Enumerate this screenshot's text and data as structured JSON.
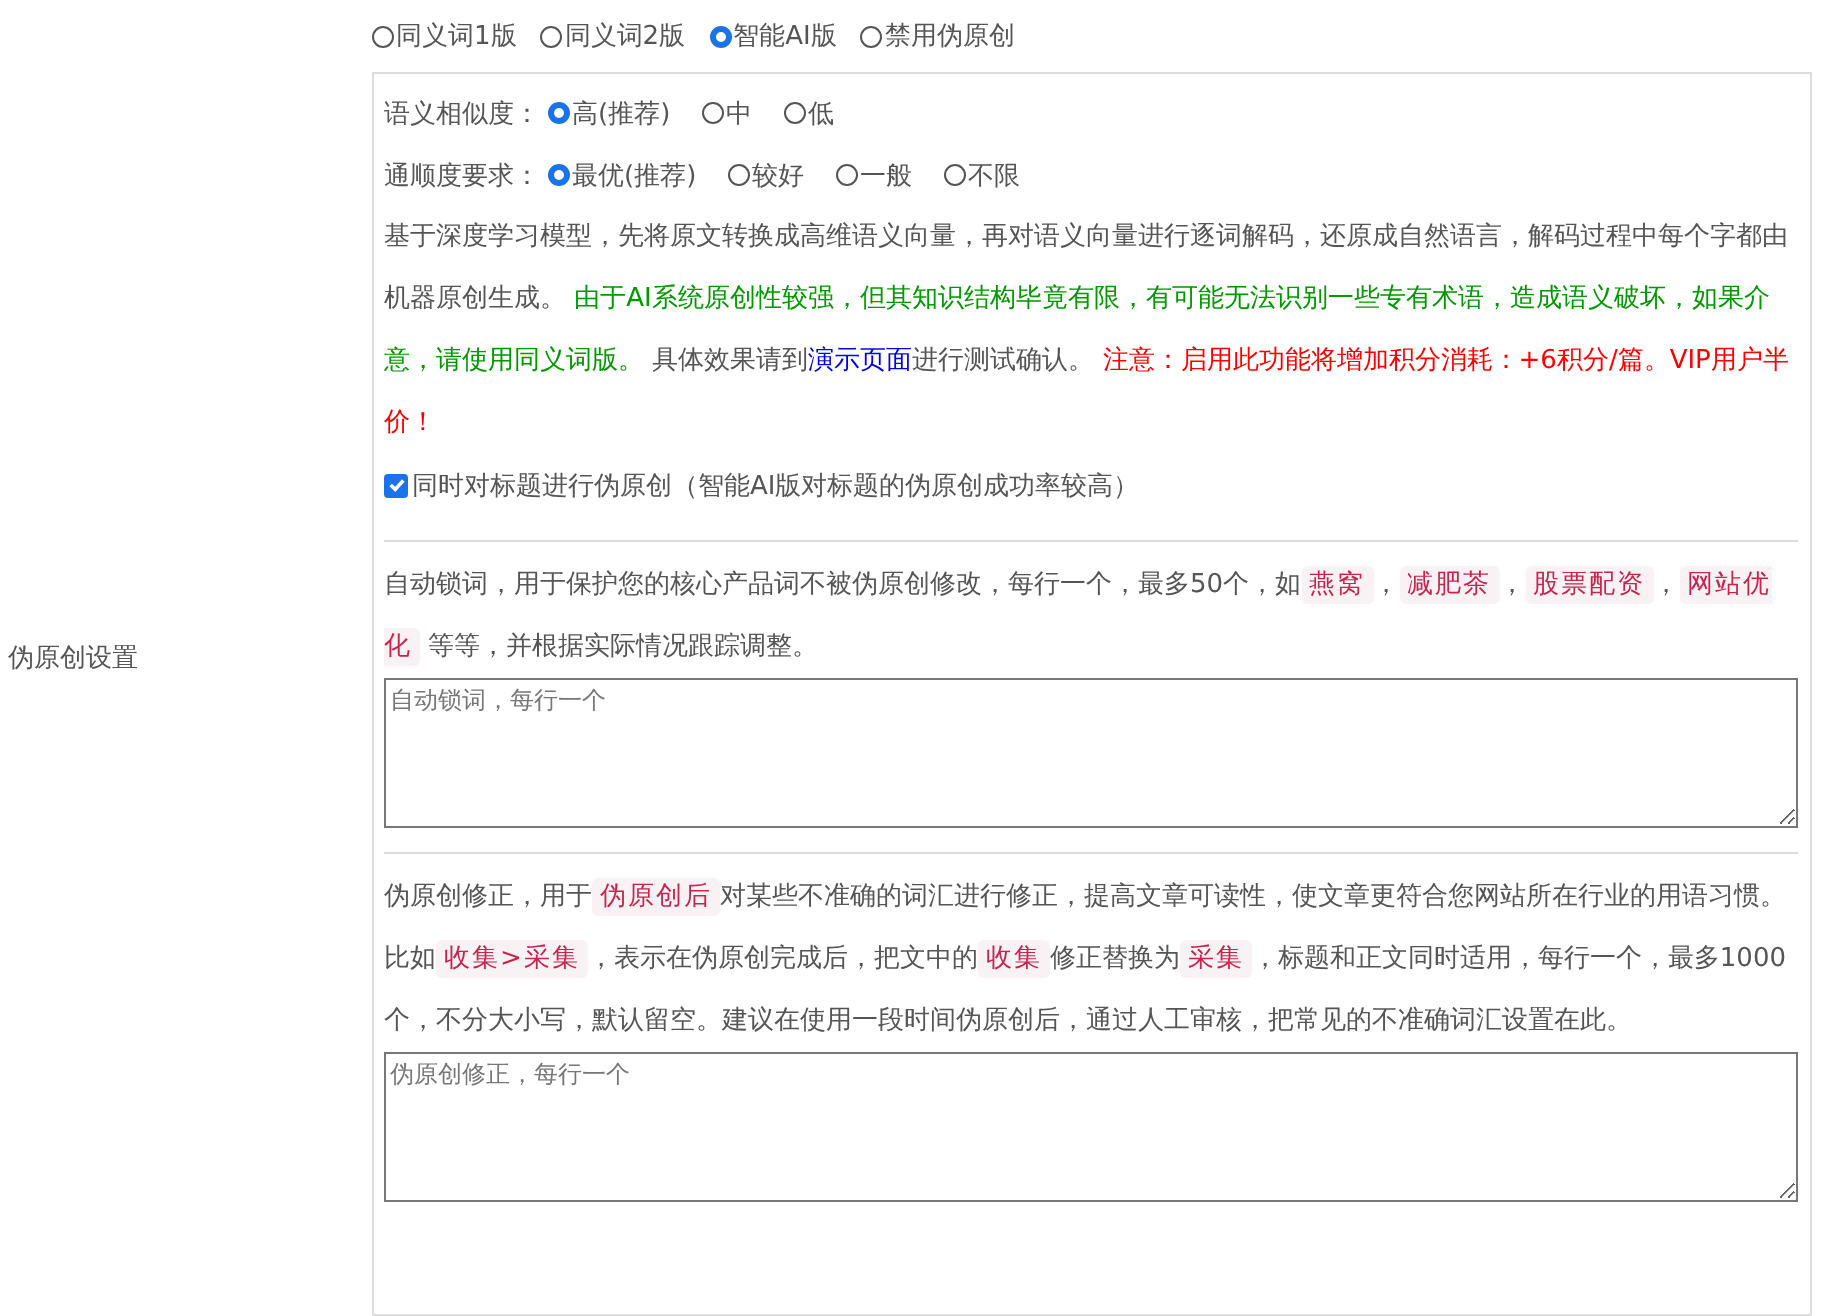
{
  "side_label": "伪原创设置",
  "modes": [
    {
      "label": "同义词1版",
      "selected": false
    },
    {
      "label": "同义词2版",
      "selected": false
    },
    {
      "label": "智能AI版",
      "selected": true
    },
    {
      "label": "禁用伪原创",
      "selected": false
    }
  ],
  "similarity": {
    "label": "语义相似度：",
    "options": [
      {
        "label": "高(推荐)",
        "selected": true
      },
      {
        "label": "中",
        "selected": false
      },
      {
        "label": "低",
        "selected": false
      }
    ]
  },
  "fluency": {
    "label": "通顺度要求：",
    "options": [
      {
        "label": "最优(推荐)",
        "selected": true
      },
      {
        "label": "较好",
        "selected": false
      },
      {
        "label": "一般",
        "selected": false
      },
      {
        "label": "不限",
        "selected": false
      }
    ]
  },
  "ai_description": [
    {
      "kind": "plain",
      "text": "基于深度学习模型，先将原文转换成高维语义向量，再对语义向量进行逐词解码，还原成自然语言，解码过程中每个字都由机器原创生成。 "
    },
    {
      "kind": "green",
      "text": "由于AI系统原创性较强，但其知识结构毕竟有限，有可能无法识别一些专有术语，造成语义破坏，如果介意，请使用同义词版。"
    },
    {
      "kind": "plain",
      "text": " 具体效果请到"
    },
    {
      "kind": "link",
      "text": "演示页面"
    },
    {
      "kind": "plain",
      "text": "进行测试确认。 "
    },
    {
      "kind": "red",
      "text": "注意：启用此功能将增加积分消耗：+6积分/篇。VIP用户半价！"
    }
  ],
  "title_option": {
    "label": "同时对标题进行伪原创（智能AI版对标题的伪原创成功率较高）",
    "checked": true
  },
  "lock_words": {
    "description": [
      {
        "kind": "plain",
        "text": "自动锁词，用于保护您的核心产品词不被伪原创修改，每行一个，最多50个，如"
      },
      {
        "kind": "code",
        "text": "燕窝"
      },
      {
        "kind": "plain",
        "text": "，"
      },
      {
        "kind": "code",
        "text": "减肥茶"
      },
      {
        "kind": "plain",
        "text": "，"
      },
      {
        "kind": "code",
        "text": "股票配资"
      },
      {
        "kind": "plain",
        "text": "，"
      },
      {
        "kind": "code",
        "text": "网站优化"
      },
      {
        "kind": "plain",
        "text": " 等等，并根据实际情况跟踪调整。"
      }
    ],
    "placeholder": "自动锁词，每行一个"
  },
  "corrections": {
    "description": [
      {
        "kind": "plain",
        "text": "伪原创修正，用于"
      },
      {
        "kind": "code",
        "text": "伪原创后"
      },
      {
        "kind": "plain",
        "text": "对某些不准确的词汇进行修正，提高文章可读性，使文章更符合您网站所在行业的用语习惯。比如"
      },
      {
        "kind": "code",
        "text": "收集>采集"
      },
      {
        "kind": "plain",
        "text": "，表示在伪原创完成后，把文中的"
      },
      {
        "kind": "code",
        "text": "收集"
      },
      {
        "kind": "plain",
        "text": "修正替换为"
      },
      {
        "kind": "code",
        "text": "采集"
      },
      {
        "kind": "plain",
        "text": "，标题和正文同时适用，每行一个，最多1000个，不分大小写，默认留空。建议在使用一段时间伪原创后，通过人工审核，把常见的不准确词汇设置在此。"
      }
    ],
    "placeholder": "伪原创修正，每行一个"
  }
}
